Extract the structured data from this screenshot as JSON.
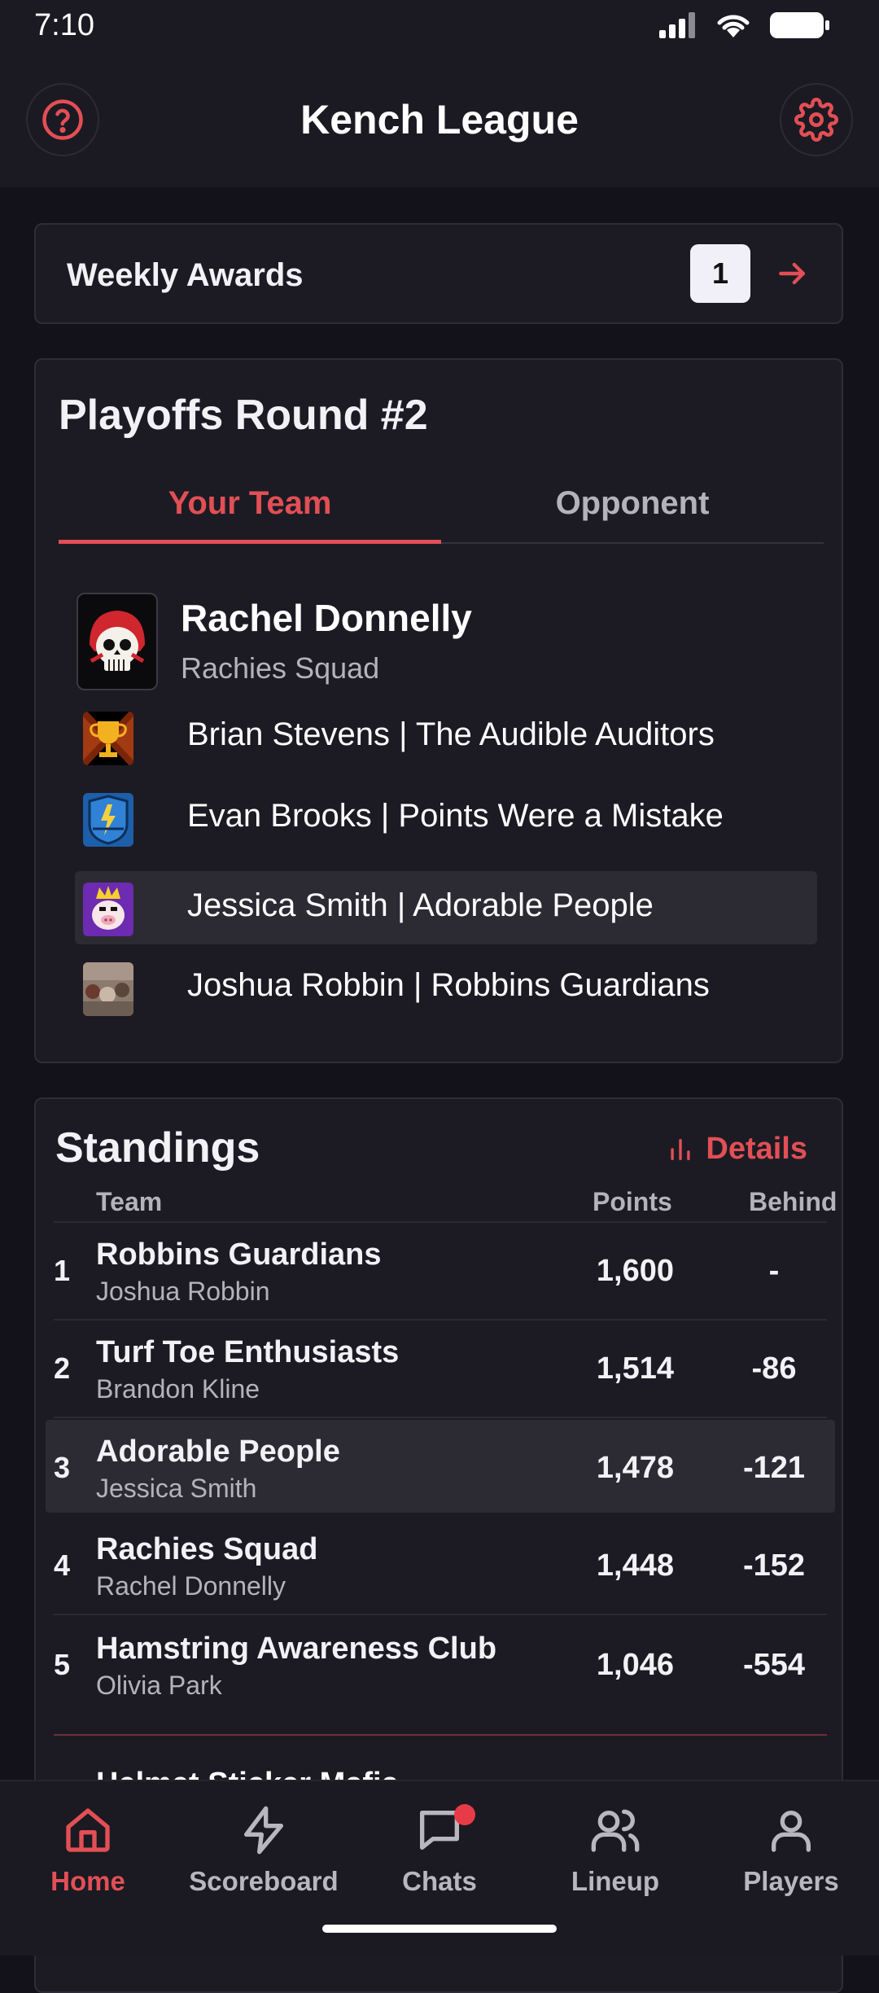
{
  "status_bar": {
    "time": "7:10"
  },
  "header": {
    "title": "Kench League"
  },
  "weekly_awards": {
    "label": "Weekly Awards",
    "count": "1"
  },
  "playoffs": {
    "title": "Playoffs Round #2",
    "tabs": [
      {
        "label": "Your Team",
        "active": true
      },
      {
        "label": "Opponent",
        "active": false
      }
    ],
    "owner": {
      "name": "Rachel Donnelly",
      "team": "Rachies Squad"
    },
    "members": [
      {
        "text": "Brian Stevens | The Audible Auditors",
        "icon": "trophy-avatar-icon",
        "highlighted": false
      },
      {
        "text": "Evan Brooks | Points Were a Mistake",
        "icon": "blue-crest-avatar-icon",
        "highlighted": false
      },
      {
        "text": "Jessica Smith | Adorable People",
        "icon": "crowned-pig-avatar-icon",
        "highlighted": true
      },
      {
        "text": "Joshua Robbin | Robbins Guardians",
        "icon": "photo-avatar-icon",
        "highlighted": false
      }
    ]
  },
  "standings": {
    "title": "Standings",
    "details_label": "Details",
    "columns": {
      "team": "Team",
      "points": "Points",
      "behind": "Behind"
    },
    "rows": [
      {
        "rank": "1",
        "team": "Robbins Guardians",
        "owner": "Joshua Robbin",
        "points": "1,600",
        "behind": "-",
        "highlighted": false
      },
      {
        "rank": "2",
        "team": "Turf Toe Enthusiasts",
        "owner": "Brandon Kline",
        "points": "1,514",
        "behind": "-86",
        "highlighted": false
      },
      {
        "rank": "3",
        "team": "Adorable People",
        "owner": "Jessica Smith",
        "points": "1,478",
        "behind": "-121",
        "highlighted": true
      },
      {
        "rank": "4",
        "team": "Rachies Squad",
        "owner": "Rachel Donnelly",
        "points": "1,448",
        "behind": "-152",
        "highlighted": false
      },
      {
        "rank": "5",
        "team": "Hamstring Awareness Club",
        "owner": "Olivia Park",
        "points": "1,046",
        "behind": "-554",
        "highlighted": false
      }
    ],
    "next_row_peek": "Helmet Sticker Mafia"
  },
  "bottom_nav": [
    {
      "label": "Home",
      "icon": "home-icon",
      "active": true
    },
    {
      "label": "Scoreboard",
      "icon": "lightning-icon",
      "active": false
    },
    {
      "label": "Chats",
      "icon": "chat-icon",
      "active": false,
      "notification": true
    },
    {
      "label": "Lineup",
      "icon": "users-icon",
      "active": false
    },
    {
      "label": "Players",
      "icon": "user-icon",
      "active": false
    }
  ],
  "colors": {
    "accent": "#e24f55",
    "background": "#13121a",
    "card": "#1c1b24",
    "highlight": "#2c2b34"
  }
}
